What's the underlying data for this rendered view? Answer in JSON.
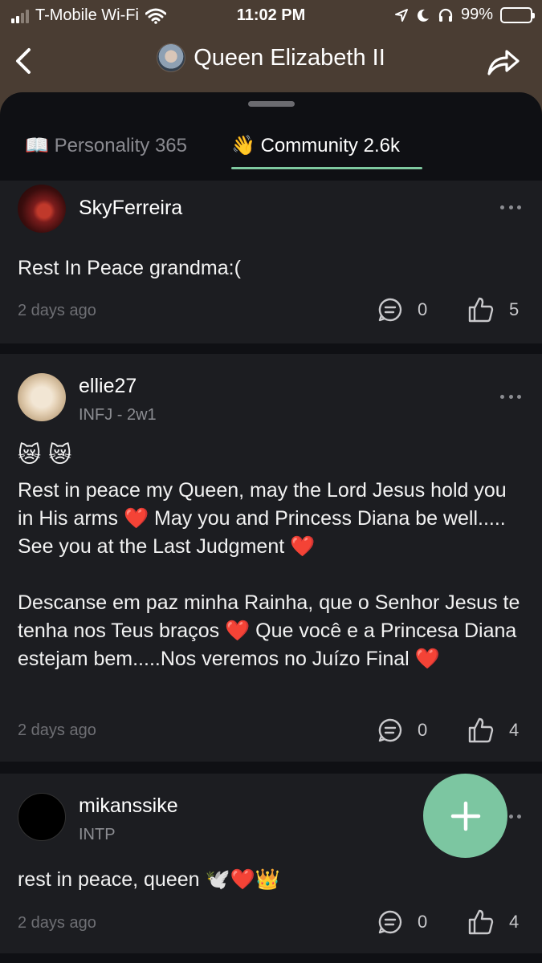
{
  "status_bar": {
    "carrier": "T-Mobile Wi-Fi",
    "time": "11:02 PM",
    "battery": "99%"
  },
  "header": {
    "title": "Queen Elizabeth II"
  },
  "tabs": [
    {
      "icon": "📖",
      "label": "Personality 365",
      "active": false
    },
    {
      "icon": "👋",
      "label": "Community 2.6k",
      "active": true
    }
  ],
  "posts": [
    {
      "username": "SkyFerreira",
      "subtitle": "",
      "body": "Rest In Peace grandma:(",
      "timestamp": "2 days ago",
      "comments": "0",
      "likes": "5"
    },
    {
      "username": "ellie27",
      "subtitle": "INFJ - 2w1",
      "emoji_line": "😿 😿",
      "body": "Rest in peace my Queen, may the Lord Jesus hold you in His arms ❤️ May you and Princess Diana be well..... See you at the Last Judgment ❤️\n\nDescanse em paz minha Rainha, que o Senhor Jesus te tenha nos Teus braços ❤️ Que você e a Princesa Diana estejam bem.....Nos veremos no Juízo Final ❤️",
      "timestamp": "2 days ago",
      "comments": "0",
      "likes": "4"
    },
    {
      "username": "mikanssike",
      "subtitle": "INTP",
      "body": "rest in peace, queen 🕊️❤️👑",
      "timestamp": "2 days ago",
      "comments": "0",
      "likes": "4"
    }
  ],
  "colors": {
    "header_bg": "#4a3d33",
    "sheet_bg": "#0f1014",
    "card_bg": "#1c1d21",
    "accent": "#7cc6a1"
  }
}
